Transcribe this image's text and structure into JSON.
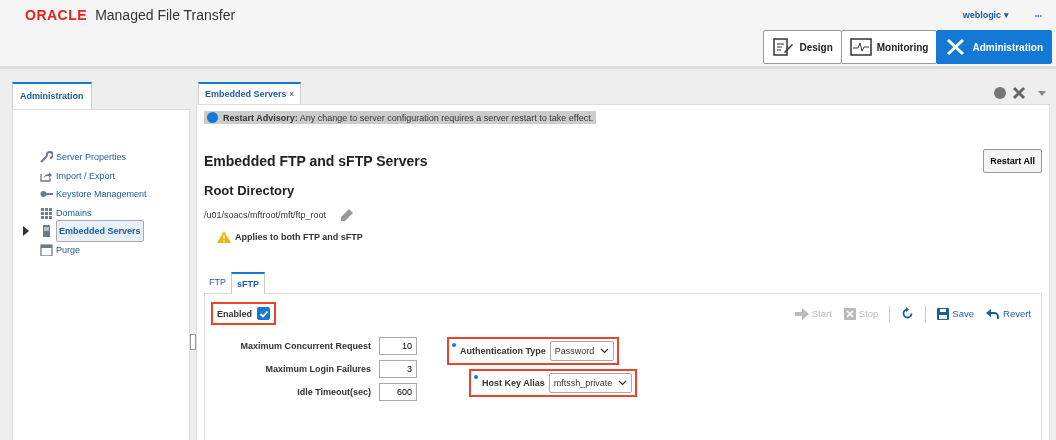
{
  "app": {
    "brand": "ORACLE",
    "title": "Managed File Transfer",
    "user": "weblogic",
    "user_caret": "▾",
    "more": "•••"
  },
  "nav": [
    {
      "label": "Design",
      "kind": "design",
      "selected": false
    },
    {
      "label": "Monitoring",
      "kind": "monitoring",
      "selected": false
    },
    {
      "label": "Administration",
      "kind": "administration",
      "selected": true
    }
  ],
  "sidebar": {
    "tab": "Administration",
    "items": [
      {
        "label": "Server Properties",
        "kind": "wrench",
        "selected": false,
        "expandable": false
      },
      {
        "label": "Import / Export",
        "kind": "export",
        "selected": false,
        "expandable": false
      },
      {
        "label": "Keystore Management",
        "kind": "key",
        "selected": false,
        "expandable": false
      },
      {
        "label": "Domains",
        "kind": "grid",
        "selected": false,
        "expandable": false
      },
      {
        "label": "Embedded Servers",
        "kind": "server",
        "selected": true,
        "expandable": true
      },
      {
        "label": "Purge",
        "kind": "calendar",
        "selected": false,
        "expandable": false
      }
    ]
  },
  "document_tab": {
    "label": "Embedded Servers",
    "close": "×"
  },
  "advisory": "**Restart Advisory:** Any change to server configuration requires a server restart to take effect.",
  "heading": "Embedded FTP and sFTP Servers",
  "restart_button": "Restart All",
  "root_directory": {
    "title": "Root Directory",
    "path": "/u01/soacs/mftroot/mft/ftp_root",
    "note": "Applies to both FTP and sFTP"
  },
  "protocol_tabs": [
    {
      "label": "FTP",
      "selected": false
    },
    {
      "label": "sFTP",
      "selected": true
    }
  ],
  "enabled": {
    "label": "Enabled",
    "checked": true,
    "highlighted": true
  },
  "toolbar": [
    {
      "label": "Start",
      "kind": "start",
      "disabled": true
    },
    {
      "label": "Stop",
      "kind": "stop",
      "disabled": true
    },
    {
      "kind": "refresh",
      "disabled": false
    },
    {
      "label": "Save",
      "kind": "save",
      "disabled": false
    },
    {
      "label": "Revert",
      "kind": "revert",
      "disabled": false
    }
  ],
  "fields": [
    {
      "label": "Maximum Concurrent Request",
      "value": "10"
    },
    {
      "label": "Maximum Login Failures",
      "value": "3"
    },
    {
      "label": "Idle Timeout(sec)",
      "value": "600"
    }
  ],
  "selects": [
    {
      "label": "Authentication Type",
      "required": true,
      "value": "Password",
      "highlighted": true
    },
    {
      "label": "Host Key Alias",
      "required": true,
      "value": "mftssh_private",
      "highlighted": true
    }
  ]
}
